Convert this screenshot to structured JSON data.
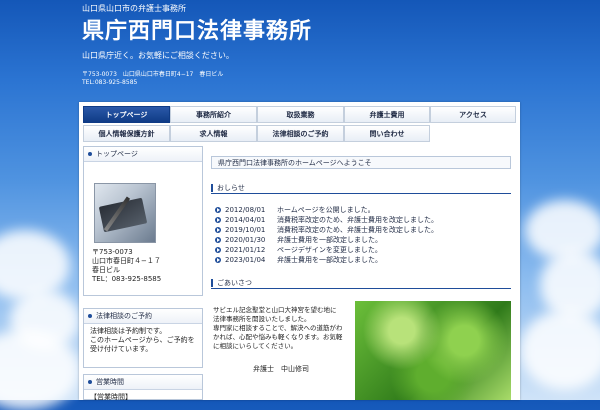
{
  "header": {
    "subtitle": "山口県山口市の弁護士事務所",
    "title": "県庁西門口法律事務所",
    "tagline": "山口県庁近く。お気軽にご相談ください。",
    "address": "〒753-0073　山口県山口市春日町4−17　春日ビル",
    "tel": "TEL:083-925-8585"
  },
  "nav": {
    "row1": [
      "トップページ",
      "事務所紹介",
      "取扱業務",
      "弁護士費用",
      "アクセス"
    ],
    "row2": [
      "個人情報保護方針",
      "求人情報",
      "法律相談のご予約",
      "問い合わせ"
    ]
  },
  "sidebar": {
    "top_heading": "トップページ",
    "postal": "〒753-0073",
    "address1": "山口市春日町４−１７",
    "address2": "春日ビル",
    "tel": "TEL：083-925-8585",
    "consult_heading": "法律相談のご予約",
    "consult_text1": "法律相談は予約制です。",
    "consult_text2": "このホームページから、ご予約を受け付けています。",
    "hours_heading": "営業時間",
    "hours_sub": "【営業時間】"
  },
  "main": {
    "welcome": "県庁西門口法律事務所のホームページへようこそ",
    "news_heading": "おしらせ",
    "news": [
      {
        "date": "2012/08/01",
        "text": "ホームページを公開しました。"
      },
      {
        "date": "2014/04/01",
        "text": "消費税率改定のため、弁護士費用を改定しました。"
      },
      {
        "date": "2019/10/01",
        "text": "消費税率改定のため、弁護士費用を改定しました。"
      },
      {
        "date": "2020/01/30",
        "text": "弁護士費用を一部改定しました。"
      },
      {
        "date": "2021/01/12",
        "text": "ページデザインを変更しました。"
      },
      {
        "date": "2023/01/04",
        "text": "弁護士費用を一部改定しました。"
      }
    ],
    "greeting_heading": "ごあいさつ",
    "greeting_lines": [
      "サビエル記念聖堂と山口大神宮を望む地に",
      "法律事務所を開設いたしました。",
      "専門家に相談することで、解決への道筋がわ",
      "かれば、心配や悩みも軽くなります。お気軽",
      "に相談にいらしてください。"
    ],
    "signature": "弁護士　中山修司"
  }
}
